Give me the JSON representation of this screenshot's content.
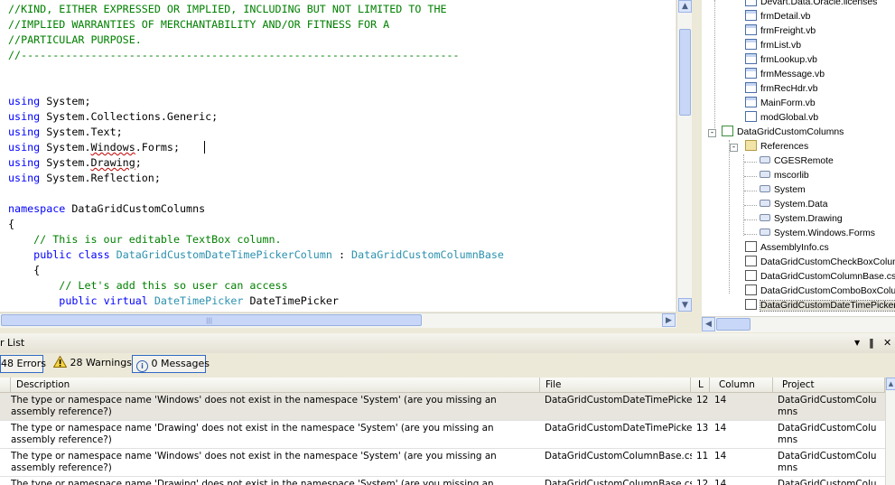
{
  "code_lines": [
    {
      "segments": [
        {
          "t": "//KIND, EITHER EXPRESSED OR IMPLIED, INCLUDING BUT NOT LIMITED TO THE",
          "c": "cm"
        }
      ]
    },
    {
      "segments": [
        {
          "t": "//IMPLIED WARRANTIES OF MERCHANTABILITY AND/OR FITNESS FOR A",
          "c": "cm"
        }
      ]
    },
    {
      "segments": [
        {
          "t": "//PARTICULAR PURPOSE.",
          "c": "cm"
        }
      ]
    },
    {
      "segments": [
        {
          "t": "//---------------------------------------------------------------------",
          "c": "cm"
        }
      ]
    },
    {
      "segments": []
    },
    {
      "segments": []
    },
    {
      "segments": [
        {
          "t": "using",
          "c": "kw"
        },
        {
          "t": " System;",
          "c": ""
        }
      ]
    },
    {
      "segments": [
        {
          "t": "using",
          "c": "kw"
        },
        {
          "t": " System.Collections.Generic;",
          "c": ""
        }
      ]
    },
    {
      "segments": [
        {
          "t": "using",
          "c": "kw"
        },
        {
          "t": " System.Text;",
          "c": ""
        }
      ]
    },
    {
      "segments": [
        {
          "t": "using",
          "c": "kw"
        },
        {
          "t": " System.",
          "c": ""
        },
        {
          "t": "Windows",
          "c": "squig"
        },
        {
          "t": ".Forms;",
          "c": ""
        }
      ]
    },
    {
      "segments": [
        {
          "t": "using",
          "c": "kw"
        },
        {
          "t": " System.",
          "c": ""
        },
        {
          "t": "Drawing",
          "c": "squig"
        },
        {
          "t": ";",
          "c": ""
        }
      ]
    },
    {
      "segments": [
        {
          "t": "using",
          "c": "kw"
        },
        {
          "t": " System.Reflection;",
          "c": ""
        }
      ]
    },
    {
      "segments": []
    },
    {
      "segments": [
        {
          "t": "namespace",
          "c": "kw"
        },
        {
          "t": " DataGridCustomColumns",
          "c": ""
        }
      ]
    },
    {
      "segments": [
        {
          "t": "{",
          "c": ""
        }
      ]
    },
    {
      "segments": [
        {
          "t": "    // This is our editable TextBox column.",
          "c": "cm"
        }
      ]
    },
    {
      "segments": [
        {
          "t": "    ",
          "c": ""
        },
        {
          "t": "public",
          "c": "kw"
        },
        {
          "t": " ",
          "c": ""
        },
        {
          "t": "class",
          "c": "kw"
        },
        {
          "t": " ",
          "c": ""
        },
        {
          "t": "DataGridCustomDateTimePickerColumn",
          "c": "ty"
        },
        {
          "t": " : ",
          "c": ""
        },
        {
          "t": "DataGridCustomColumnBase",
          "c": "ty"
        }
      ]
    },
    {
      "segments": [
        {
          "t": "    {",
          "c": ""
        }
      ]
    },
    {
      "segments": [
        {
          "t": "        // Let's add this so user can access",
          "c": "cm"
        }
      ]
    },
    {
      "segments": [
        {
          "t": "        ",
          "c": ""
        },
        {
          "t": "public",
          "c": "kw"
        },
        {
          "t": " ",
          "c": ""
        },
        {
          "t": "virtual",
          "c": "kw"
        },
        {
          "t": " ",
          "c": ""
        },
        {
          "t": "DateTimePicker",
          "c": "ty"
        },
        {
          "t": " DateTimePicker",
          "c": ""
        }
      ]
    }
  ],
  "solution_tree": [
    {
      "label": "Devart.Data.Oracle.licenses",
      "icon": "form-icon",
      "level": 3
    },
    {
      "label": "frmDetail.vb",
      "icon": "form-icon",
      "level": 3
    },
    {
      "label": "frmFreight.vb",
      "icon": "form-icon",
      "level": 3
    },
    {
      "label": "frmList.vb",
      "icon": "form-icon",
      "level": 3
    },
    {
      "label": "frmLookup.vb",
      "icon": "form-icon",
      "level": 3
    },
    {
      "label": "frmMessage.vb",
      "icon": "form-icon",
      "level": 3
    },
    {
      "label": "frmRecHdr.vb",
      "icon": "form-icon",
      "level": 3
    },
    {
      "label": "MainForm.vb",
      "icon": "form-icon",
      "level": 3
    },
    {
      "label": "modGlobal.vb",
      "icon": "vb-file-icon",
      "level": 3
    },
    {
      "label": "DataGridCustomColumns",
      "icon": "csharp-project-icon",
      "level": 1,
      "expander": "-"
    },
    {
      "label": "References",
      "icon": "folder-icon",
      "level": 2,
      "expander": "-"
    },
    {
      "label": "CGESRemote",
      "icon": "reference-icon",
      "level": 3
    },
    {
      "label": "mscorlib",
      "icon": "reference-icon",
      "level": 3
    },
    {
      "label": "System",
      "icon": "reference-icon",
      "level": 3
    },
    {
      "label": "System.Data",
      "icon": "reference-icon",
      "level": 3
    },
    {
      "label": "System.Drawing",
      "icon": "reference-icon",
      "level": 3
    },
    {
      "label": "System.Windows.Forms",
      "icon": "reference-icon",
      "level": 3
    },
    {
      "label": "AssemblyInfo.cs",
      "icon": "cs-file-icon",
      "level": 2
    },
    {
      "label": "DataGridCustomCheckBoxColumn.cs",
      "icon": "cs-file-icon",
      "level": 2
    },
    {
      "label": "DataGridCustomColumnBase.cs",
      "icon": "cs-file-icon",
      "level": 2
    },
    {
      "label": "DataGridCustomComboBoxColumn.cs",
      "icon": "cs-file-icon",
      "level": 2
    },
    {
      "label": "DataGridCustomDateTimePickerColumn.cs",
      "icon": "cs-file-icon",
      "level": 2,
      "selected": true
    }
  ],
  "error_list": {
    "title": "r List",
    "errors_label": "48 Errors",
    "warnings_label": "28 Warnings",
    "messages_label": "0 Messages",
    "pin_glyph": "‖",
    "dropdown_glyph": "▼",
    "close_glyph": "✕",
    "columns": {
      "description": "Description",
      "file": "File",
      "line": "L",
      "column": "Column",
      "project": "Project"
    },
    "rows": [
      {
        "description": "The type or namespace name 'Windows' does not exist in the namespace 'System' (are you missing an assembly reference?)",
        "file": "DataGridCustomDateTimePickerCo",
        "line": "12",
        "column": "14",
        "project": "DataGridCustomColumns"
      },
      {
        "description": "The type or namespace name 'Drawing' does not exist in the namespace 'System' (are you missing an assembly reference?)",
        "file": "DataGridCustomDateTimePickerCo",
        "line": "13",
        "column": "14",
        "project": "DataGridCustomColumns"
      },
      {
        "description": "The type or namespace name 'Windows' does not exist in the namespace 'System' (are you missing an assembly reference?)",
        "file": "DataGridCustomColumnBase.cs",
        "line": "11",
        "column": "14",
        "project": "DataGridCustomColumns"
      },
      {
        "description": "The type or namespace name 'Drawing' does not exist in the namespace 'System' (are you missing an assembly reference?)",
        "file": "DataGridCustomColumnBase.cs",
        "line": "12",
        "column": "14",
        "project": "DataGridCustomColumns"
      }
    ]
  },
  "scroll": {
    "up": "▲",
    "down": "▼",
    "left": "◀",
    "right": "▶",
    "grip": "|||"
  },
  "colors": {
    "keyword": "#0000ff",
    "comment": "#008000",
    "type": "#2b91af",
    "selection": "#316ac5"
  }
}
